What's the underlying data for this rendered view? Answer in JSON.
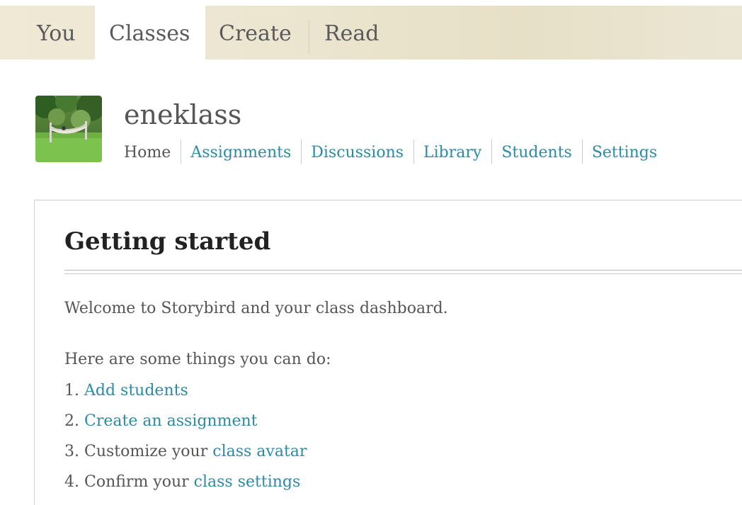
{
  "topnav": {
    "tabs": [
      {
        "label": "You"
      },
      {
        "label": "Classes"
      },
      {
        "label": "Create"
      },
      {
        "label": "Read"
      }
    ],
    "active_tab": "Classes"
  },
  "class": {
    "name": "eneklass",
    "avatar_icon": "class-avatar-image"
  },
  "subnav": {
    "items": [
      {
        "label": "Home"
      },
      {
        "label": "Assignments"
      },
      {
        "label": "Discussions"
      },
      {
        "label": "Library"
      },
      {
        "label": "Students"
      },
      {
        "label": "Settings"
      }
    ],
    "current": "Home"
  },
  "main": {
    "heading": "Getting started",
    "welcome": "Welcome to Storybird and your class dashboard.",
    "intro": "Here are some things you can do:",
    "steps": [
      {
        "number": "1.",
        "text": "",
        "link": "Add students"
      },
      {
        "number": "2.",
        "text": "",
        "link": "Create an assignment"
      },
      {
        "number": "3.",
        "text": "Customize your",
        "link": "class avatar"
      },
      {
        "number": "4.",
        "text": "Confirm your",
        "link": "class settings"
      }
    ]
  },
  "colors": {
    "link": "#2d8aa3",
    "text": "#555555",
    "heading": "#222222",
    "nav_bar": "#ece6d1"
  }
}
